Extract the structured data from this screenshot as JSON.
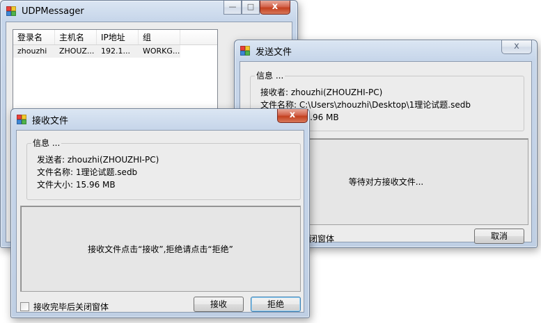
{
  "main_window": {
    "title": "UDPMessager",
    "minimize_glyph": "—",
    "maximize_glyph": "□",
    "close_glyph": "x",
    "columns": [
      "登录名",
      "主机名",
      "IP地址",
      "组"
    ],
    "rows": [
      [
        "zhouzhi",
        "ZHOUZ...",
        "192.1...",
        "WORKG..."
      ]
    ]
  },
  "send_window": {
    "title": "发送文件",
    "close_glyph": "x",
    "group_label": "信息 ...",
    "receiver": "接收者: zhouzhi(ZHOUZHI-PC)",
    "file_name": "文件名称: C:\\Users\\zhouzhi\\Desktop\\1理论试题.sedb",
    "file_size": "文件大小: 15.96 MB",
    "status": "等待对方接收文件...",
    "close_after_label": "接收完毕后关闭窗体",
    "cancel_label": "取消"
  },
  "receive_window": {
    "title": "接收文件",
    "close_glyph": "x",
    "group_label": "信息 ...",
    "sender": "发送者: zhouzhi(ZHOUZHI-PC)",
    "file_name": "文件名称: 1理论试题.sedb",
    "file_size": "文件大小: 15.96 MB",
    "status": "接收文件点击“接收”,拒绝请点击“拒绝”",
    "close_after_label": "接收完毕后关闭窗体",
    "accept_label": "接收",
    "reject_label": "拒绝"
  },
  "icons": {
    "app": "app-icon-four-squares",
    "close": "close-icon",
    "minimize": "minimize-icon",
    "maximize": "maximize-icon"
  },
  "colors": {
    "close_button": "#c4401f",
    "window_frame": "#c7d6ea",
    "focus_border": "#3c7fb1"
  }
}
